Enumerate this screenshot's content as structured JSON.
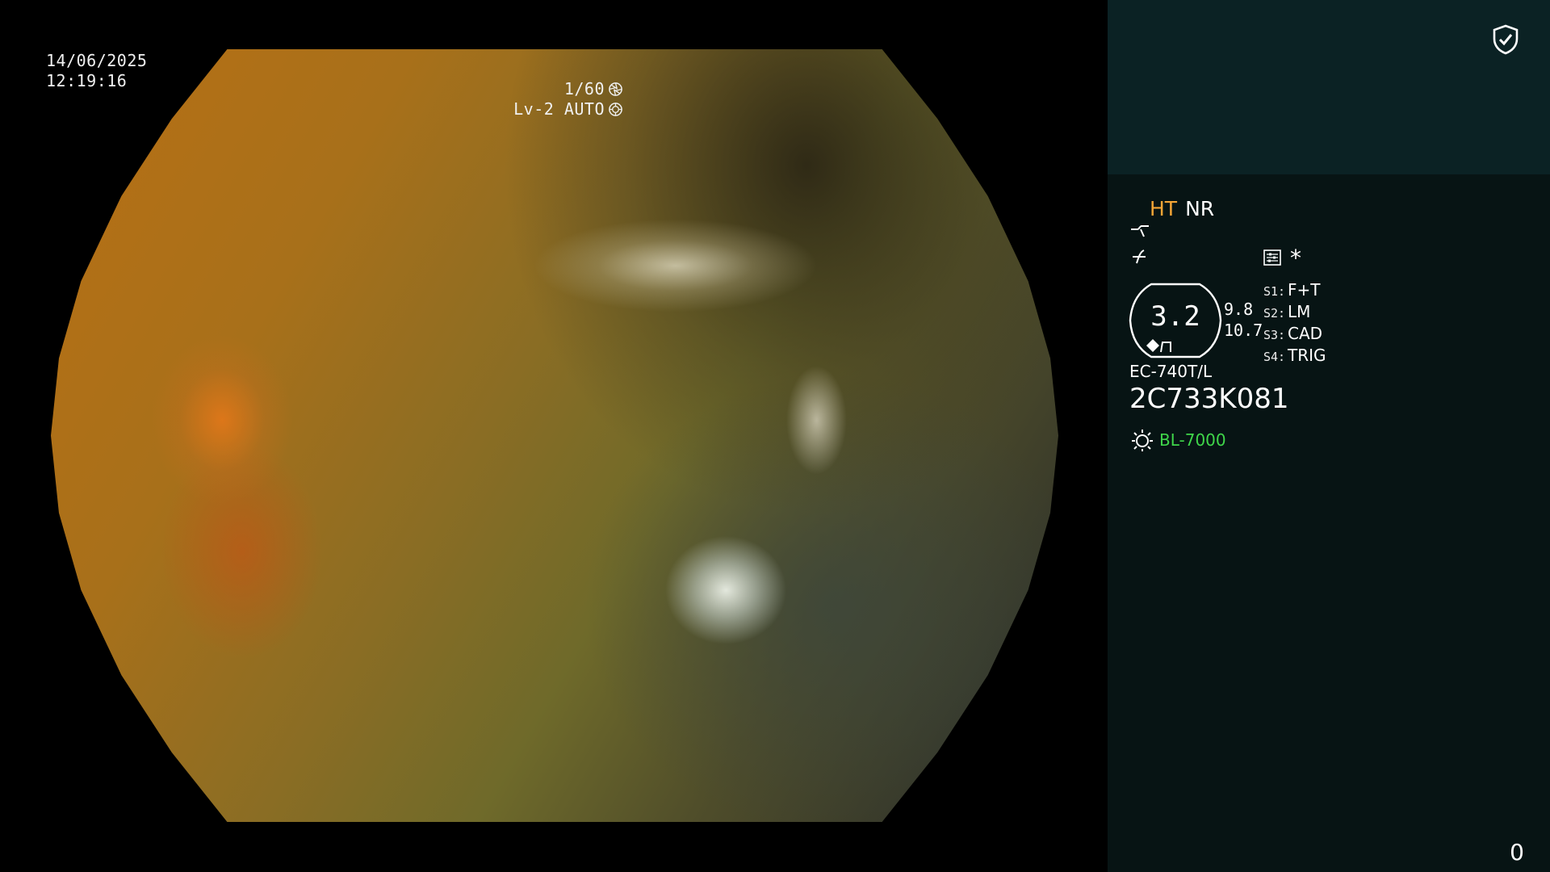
{
  "overlay": {
    "date": "14/06/2025",
    "time": "12:19:16",
    "shutter": "1/60",
    "iris_mode": "Lv-2 AUTO"
  },
  "panel": {
    "mode_ht": "HT",
    "mode_nr": "NR",
    "scope_value": "3.2",
    "side_value_1": "9.8",
    "side_value_2": "10.7",
    "slots": [
      {
        "key": "S1:",
        "value": "F+T"
      },
      {
        "key": "S2:",
        "value": "LM"
      },
      {
        "key": "S3:",
        "value": "CAD"
      },
      {
        "key": "S4:",
        "value": "TRIG"
      }
    ],
    "asterisk": "*",
    "scope_model": "EC-740T/L",
    "scope_serial": "2C733K081",
    "light_source": "BL-7000",
    "counter": "0"
  },
  "colors": {
    "ht": "#f4a536",
    "light_source": "#3fd64a",
    "panel_top": "#0b2224",
    "panel_bg": "#071414"
  },
  "icons": {
    "shutter": "aperture-icon",
    "iris": "iris-icon",
    "security": "shield-check-icon",
    "enhance": "enhance-curve-icon",
    "contrast": "contrast-icon",
    "settings": "settings-panel-icon",
    "light": "light-source-icon"
  }
}
